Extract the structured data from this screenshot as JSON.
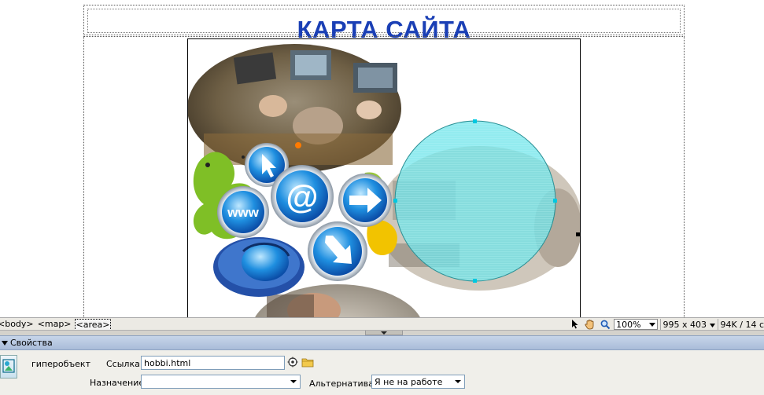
{
  "document": {
    "title": "КАРТА САЙТА"
  },
  "status_bar": {
    "tags": [
      "<body>",
      "<map>",
      "<area>"
    ],
    "zoom": "100%",
    "dimensions": "995 x 403",
    "file_size": "94K / 14 с"
  },
  "properties": {
    "panel_title": "Свойства",
    "type_label": "гиперобъект",
    "link_label": "Ссылка",
    "link_value": "hobbi.html",
    "target_label": "Назначение",
    "target_value": "",
    "alt_label": "Альтернатива",
    "alt_value": "Я не на работе"
  },
  "colors": {
    "title": "#1a3fb5",
    "hotspot_fill": "#5fe3e8",
    "hotspot_handle": "#00c8e0",
    "panel_header": "#b8c8e1"
  },
  "icons": {
    "pointer": "arrow-pointer-icon",
    "hand": "hand-icon",
    "zoom": "magnifier-icon",
    "point_to_file": "point-to-file-icon",
    "browse": "folder-icon",
    "hotspot": "hotspot-icon"
  }
}
